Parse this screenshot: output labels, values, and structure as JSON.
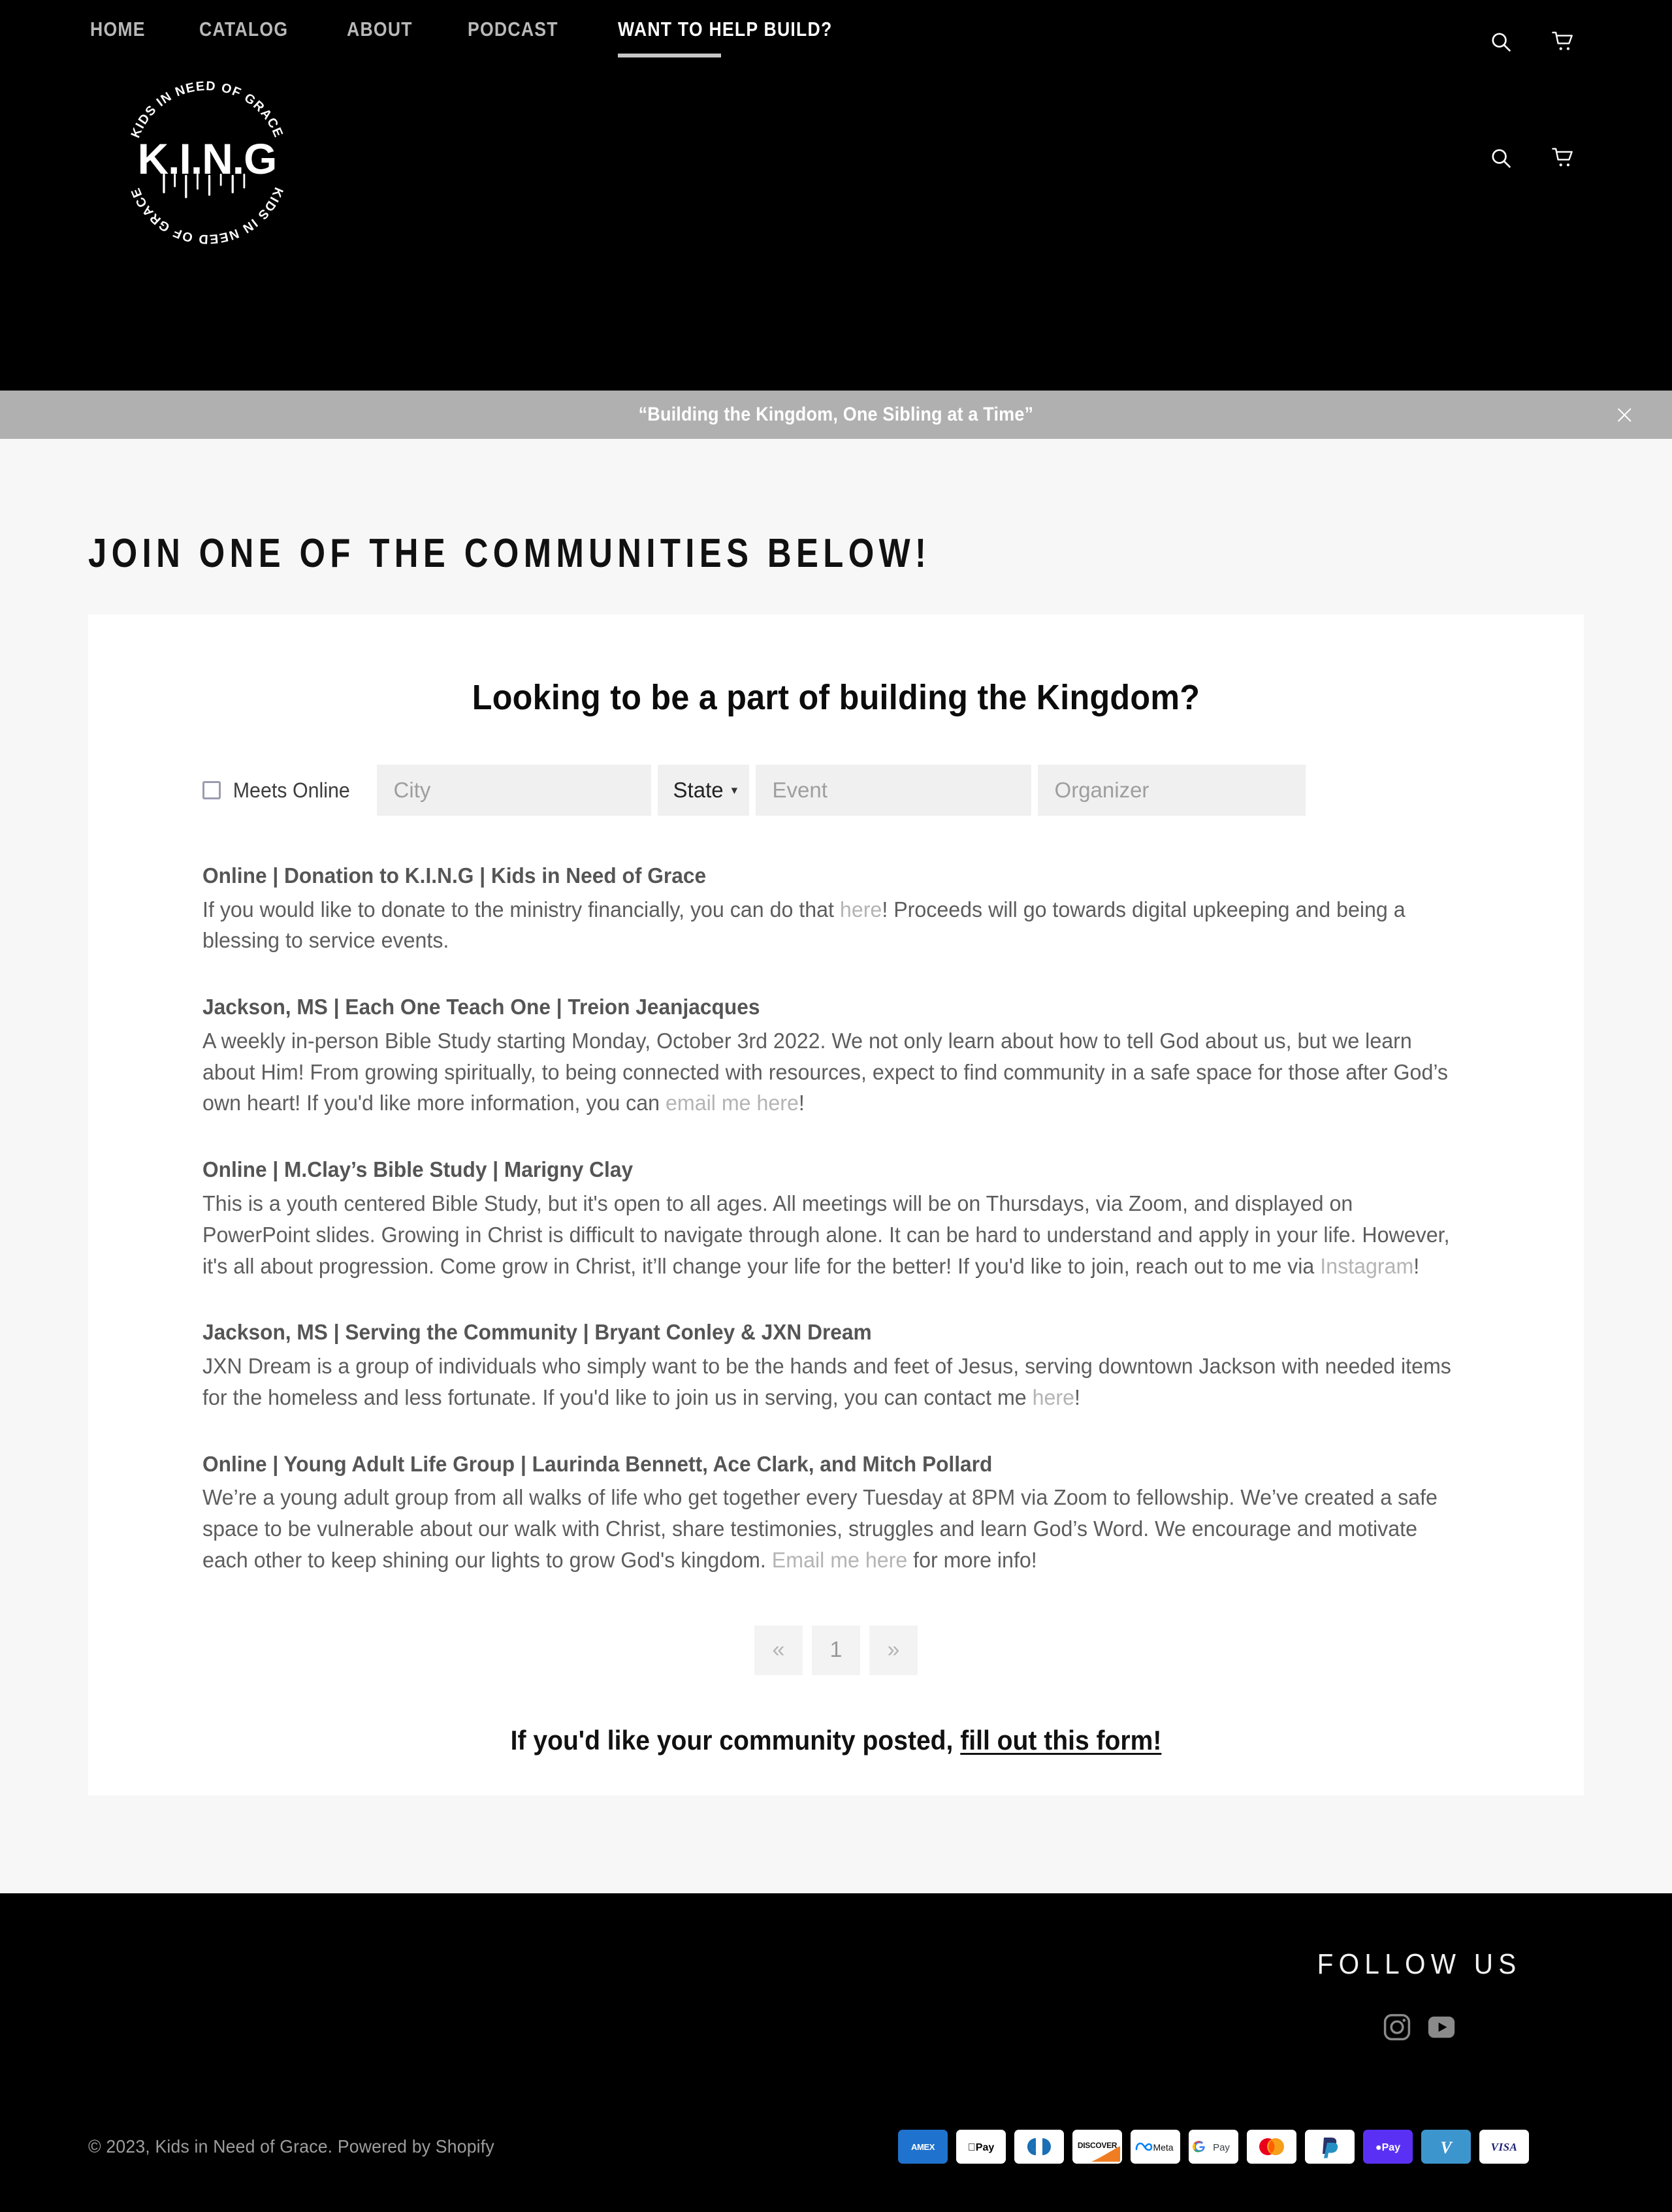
{
  "header": {
    "nav": [
      {
        "label": "Home",
        "active": false
      },
      {
        "label": "Catalog",
        "active": false
      },
      {
        "label": "About",
        "active": false
      },
      {
        "label": "Podcast",
        "active": false
      },
      {
        "label": "Want to help build?",
        "active": true
      }
    ],
    "search_icon": "search-icon",
    "cart_icon": "cart-icon",
    "logo": {
      "center_text": "K.I.N.G",
      "ring_text": "KIDS IN NEED OF GRACE KIDS IN NEED OF GRACE"
    }
  },
  "announcement": {
    "text": "“Building the Kingdom, One Sibling at a Time”",
    "close_label": "×",
    "background": "#b0b0b0"
  },
  "main": {
    "page_title": "Join one of the communities below!",
    "card_title": "Looking to be a part of building the Kingdom?",
    "filters": {
      "meets_online_label": "Meets Online",
      "meets_online_checked": false,
      "city_placeholder": "City",
      "city_value": "",
      "state_label": "State",
      "state_caret": "▾",
      "event_placeholder": "Event",
      "event_value": "",
      "organizer_placeholder": "Organizer",
      "organizer_value": ""
    },
    "listings": [
      {
        "title": "Online | Donation to K.I.N.G | Kids in Need of Grace",
        "parts": [
          {
            "t": "If you would like to donate to the ministry financially, you can do that ",
            "link": false
          },
          {
            "t": "here",
            "link": true
          },
          {
            "t": "! Proceeds will go towards digital upkeeping and being a blessing to service events.",
            "link": false
          }
        ]
      },
      {
        "title": "Jackson, MS | Each One Teach One | Treion Jeanjacques",
        "parts": [
          {
            "t": "A weekly in-person Bible Study starting Monday, October 3rd 2022. We not only learn about how to tell God about us, but we learn about Him! From growing spiritually, to being connected with resources, expect to find community in a safe space for those after God’s own heart! If you'd like more information, you can ",
            "link": false
          },
          {
            "t": "email me here",
            "link": true
          },
          {
            "t": "!",
            "link": false
          }
        ]
      },
      {
        "title": "Online | M.Clay’s Bible Study | Marigny Clay",
        "parts": [
          {
            "t": "This is a youth centered Bible Study, but it's open to all ages. All meetings will be on Thursdays, via Zoom, and displayed on PowerPoint slides. Growing in Christ is difficult to navigate through alone. It can be hard to understand and apply in your life. However, it's all about progression. Come grow in Christ, it’ll change your life for the better! If you'd like to join, reach out to me via ",
            "link": false
          },
          {
            "t": "Instagram",
            "link": true
          },
          {
            "t": "!",
            "link": false
          }
        ]
      },
      {
        "title": "Jackson, MS | Serving the Community | Bryant Conley & JXN Dream",
        "parts": [
          {
            "t": "JXN Dream is a group of individuals who simply want to be the hands and feet of Jesus, serving downtown Jackson with needed items for the homeless and less fortunate. If you'd like to join us in serving, you can contact me ",
            "link": false
          },
          {
            "t": "here",
            "link": true
          },
          {
            "t": "!",
            "link": false
          }
        ]
      },
      {
        "title": "Online | Young Adult Life Group | Laurinda Bennett, Ace Clark, and Mitch Pollard",
        "parts": [
          {
            "t": "We’re a young adult group from all walks of life who get together every Tuesday at 8PM via Zoom to fellowship. We’ve created a safe space to be vulnerable about our walk with Christ, share testimonies, struggles and learn God’s Word. We encourage and motivate each other to keep shining our lights to grow God's kingdom. ",
            "link": false
          },
          {
            "t": "Email me here",
            "link": true
          },
          {
            "t": " for more info!",
            "link": false
          }
        ]
      }
    ],
    "pagination": {
      "prev": "«",
      "pages": [
        "1"
      ],
      "next": "»",
      "current": "1"
    },
    "cta": {
      "text": "If you'd like your community posted, ",
      "link_label": "fill out this form!"
    }
  },
  "footer": {
    "follow_title": "Follow us",
    "social": [
      {
        "name": "instagram-icon",
        "label": "Instagram"
      },
      {
        "name": "youtube-icon",
        "label": "YouTube"
      }
    ],
    "copyright_prefix": "© 2023, ",
    "shop_name": "Kids in Need of Grace",
    "copyright_mid": ". ",
    "powered_by": "Powered by Shopify",
    "payments": [
      "American Express",
      "Apple Pay",
      "Diners Club",
      "Discover",
      "Meta Pay",
      "Google Pay",
      "Mastercard",
      "PayPal",
      "Shop Pay",
      "Venmo",
      "Visa"
    ]
  }
}
